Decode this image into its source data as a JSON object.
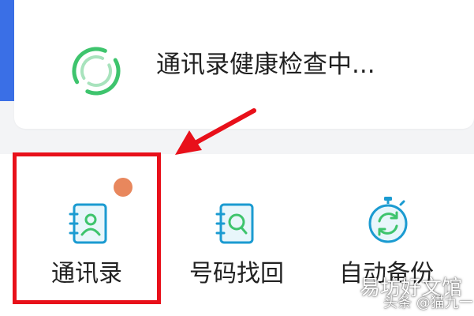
{
  "header": {
    "status_text": "通讯录健康检查中...",
    "spinner_icon": "loading-ring-icon",
    "accent_color": "#3a6fe6",
    "spinner_color": "#3ec46d"
  },
  "tools": [
    {
      "label": "通讯录",
      "icon": "contacts-book-icon",
      "has_badge": true
    },
    {
      "label": "号码找回",
      "icon": "search-book-icon",
      "has_badge": false
    },
    {
      "label": "自动备份",
      "icon": "sync-clock-icon",
      "has_badge": false
    }
  ],
  "annotation": {
    "highlight_color": "#e8101a",
    "badge_color": "#e8875d"
  },
  "watermark": {
    "main": "易坊好文馆",
    "sub": "头条 @猫九一"
  }
}
